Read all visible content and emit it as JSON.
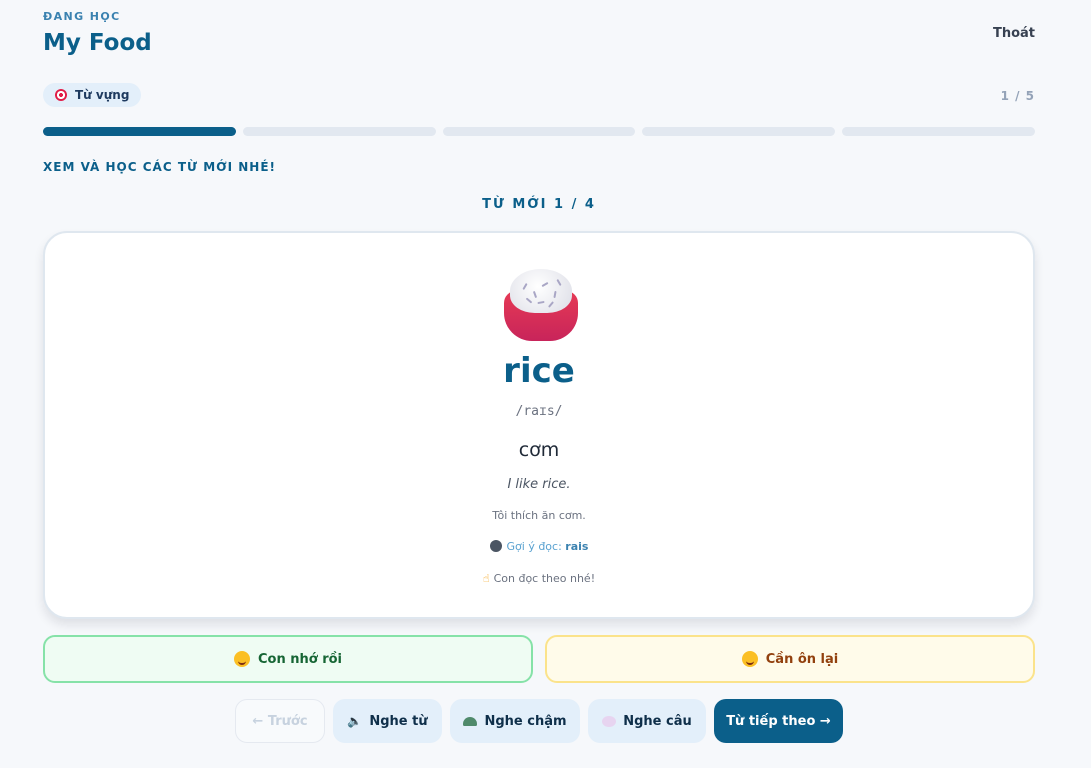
{
  "header": {
    "eyebrow": "ĐANG HỌC",
    "title": "My Food",
    "exit_label": "Thoát"
  },
  "lesson": {
    "badge_label": "Từ vựng",
    "badge_icon": "target-icon",
    "counter": "1 / 5",
    "progress_total_steps": 5,
    "progress_completed_steps": 1,
    "instruction": "XEM VÀ HỌC CÁC TỪ MỚI NHÉ!",
    "word_counter": "TỪ MỚI 1 / 4"
  },
  "card": {
    "image_icon": "rice-bowl-icon",
    "word": "rice",
    "ipa": "/raɪs/",
    "meaning": "cơm",
    "example": "I like rice.",
    "example_translation": "Tôi thích ăn cơm.",
    "hint_label": "Gợi ý đọc:",
    "hint_value": "rais",
    "read_along": "Con đọc theo nhé!"
  },
  "choices": {
    "remembered_label": "Con nhớ rồi",
    "review_label": "Cần ôn lại"
  },
  "controls": {
    "prev_label": "← Trước",
    "listen_word_label": "Nghe từ",
    "listen_slow_label": "Nghe chậm",
    "listen_sentence_label": "Nghe câu",
    "next_label": "Từ tiếp theo →"
  },
  "colors": {
    "primary": "#0b5f8a",
    "remembered_bg": "#effcf3",
    "remembered_border": "#86e2a8",
    "review_bg": "#fffbea",
    "review_border": "#fbe38b"
  }
}
